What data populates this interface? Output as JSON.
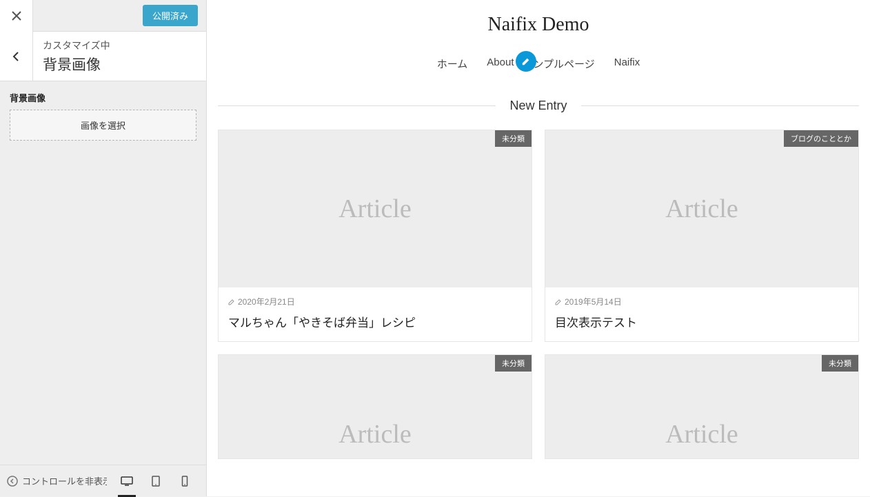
{
  "topbar": {
    "publish_label": "公開済み"
  },
  "section": {
    "eyebrow": "カスタマイズ中",
    "title": "背景画像"
  },
  "controls": {
    "bg_image_label": "背景画像",
    "select_image_label": "画像を選択"
  },
  "footer": {
    "collapse_label": "コントロールを非表示"
  },
  "site": {
    "title": "Naifix Demo",
    "nav": {
      "home": "ホーム",
      "about": "About",
      "sample": "ンプルページ",
      "naifix": "Naifix"
    },
    "section_label": "New Entry",
    "thumb_placeholder": "Article",
    "cards": [
      {
        "tag": "未分類",
        "date": "2020年2月21日",
        "title": "マルちゃん「やきそば弁当」レシピ"
      },
      {
        "tag": "ブログのこととか",
        "date": "2019年5月14日",
        "title": "目次表示テスト"
      },
      {
        "tag": "未分類",
        "date": "",
        "title": ""
      },
      {
        "tag": "未分類",
        "date": "",
        "title": ""
      }
    ]
  }
}
